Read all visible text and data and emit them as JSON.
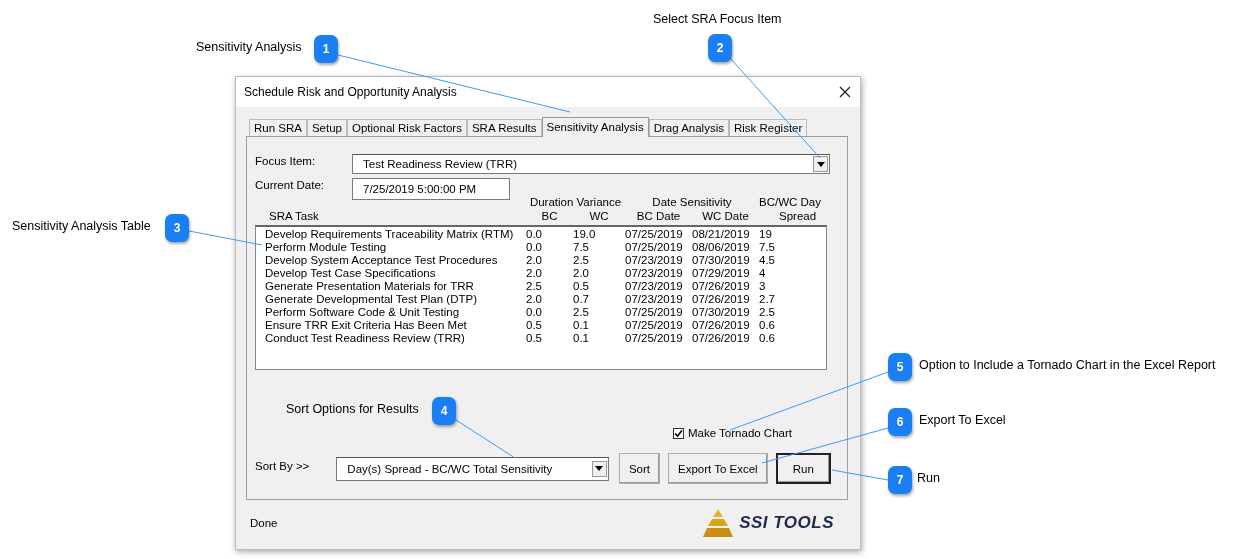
{
  "callouts": [
    {
      "number": "1",
      "label": "Sensitivity Analysis"
    },
    {
      "number": "2",
      "label": "Select SRA Focus Item"
    },
    {
      "number": "3",
      "label": "Sensitivity Analysis Table"
    },
    {
      "number": "4",
      "label": "Sort Options for Results"
    },
    {
      "number": "5",
      "label": "Option to Include a Tornado Chart in the Excel Report"
    },
    {
      "number": "6",
      "label": "Export To Excel"
    },
    {
      "number": "7",
      "label": "Run"
    }
  ],
  "dialog": {
    "title": "Schedule Risk and Opportunity Analysis",
    "tabs": [
      {
        "label": "Run SRA",
        "selected": false
      },
      {
        "label": "Setup",
        "selected": false
      },
      {
        "label": "Optional Risk Factors",
        "selected": false
      },
      {
        "label": "SRA Results",
        "selected": false
      },
      {
        "label": "Sensitivity Analysis",
        "selected": true
      },
      {
        "label": "Drag Analysis",
        "selected": false
      },
      {
        "label": "Risk Register",
        "selected": false
      }
    ],
    "focus_item": {
      "label": "Focus Item:",
      "value": "Test Readiness Review (TRR)"
    },
    "current_date": {
      "label": "Current Date:",
      "value": "7/25/2019 5:00:00 PM"
    },
    "table": {
      "group_headers": [
        "Duration Variance",
        "Date Sensitivity",
        "BC/WC Day"
      ],
      "columns": [
        "SRA Task",
        "BC",
        "WC",
        "BC Date",
        "WC Date",
        "Spread"
      ],
      "rows": [
        [
          "Develop Requirements Traceability Matrix (RTM)",
          "0.0",
          "19.0",
          "07/25/2019",
          "08/21/2019",
          "19"
        ],
        [
          "Perform Module Testing",
          "0.0",
          "7.5",
          "07/25/2019",
          "08/06/2019",
          "7.5"
        ],
        [
          "Develop System Acceptance Test Procedures",
          "2.0",
          "2.5",
          "07/23/2019",
          "07/30/2019",
          "4.5"
        ],
        [
          "Develop Test Case Specifications",
          "2.0",
          "2.0",
          "07/23/2019",
          "07/29/2019",
          "4"
        ],
        [
          "Generate Presentation Materials for TRR",
          "2.5",
          "0.5",
          "07/23/2019",
          "07/26/2019",
          "3"
        ],
        [
          "Generate Developmental Test Plan (DTP)",
          "2.0",
          "0.7",
          "07/23/2019",
          "07/26/2019",
          "2.7"
        ],
        [
          "Perform Software Code & Unit Testing",
          "0.0",
          "2.5",
          "07/25/2019",
          "07/30/2019",
          "2.5"
        ],
        [
          "Ensure TRR Exit Criteria Has Been Met",
          "0.5",
          "0.1",
          "07/25/2019",
          "07/26/2019",
          "0.6"
        ],
        [
          "Conduct Test Readiness Review (TRR)",
          "0.5",
          "0.1",
          "07/25/2019",
          "07/26/2019",
          "0.6"
        ]
      ]
    },
    "tornado_checkbox": {
      "label": "Make Tornado Chart",
      "checked": true
    },
    "sort_by": {
      "label": "Sort By >>",
      "value": "Day(s) Spread - BC/WC Total Sensitivity"
    },
    "buttons": [
      {
        "label": "Sort",
        "default": false
      },
      {
        "label": "Export To Excel",
        "default": false
      },
      {
        "label": "Run",
        "default": true
      }
    ],
    "status": "Done",
    "logo": "SSI TOOLS"
  }
}
